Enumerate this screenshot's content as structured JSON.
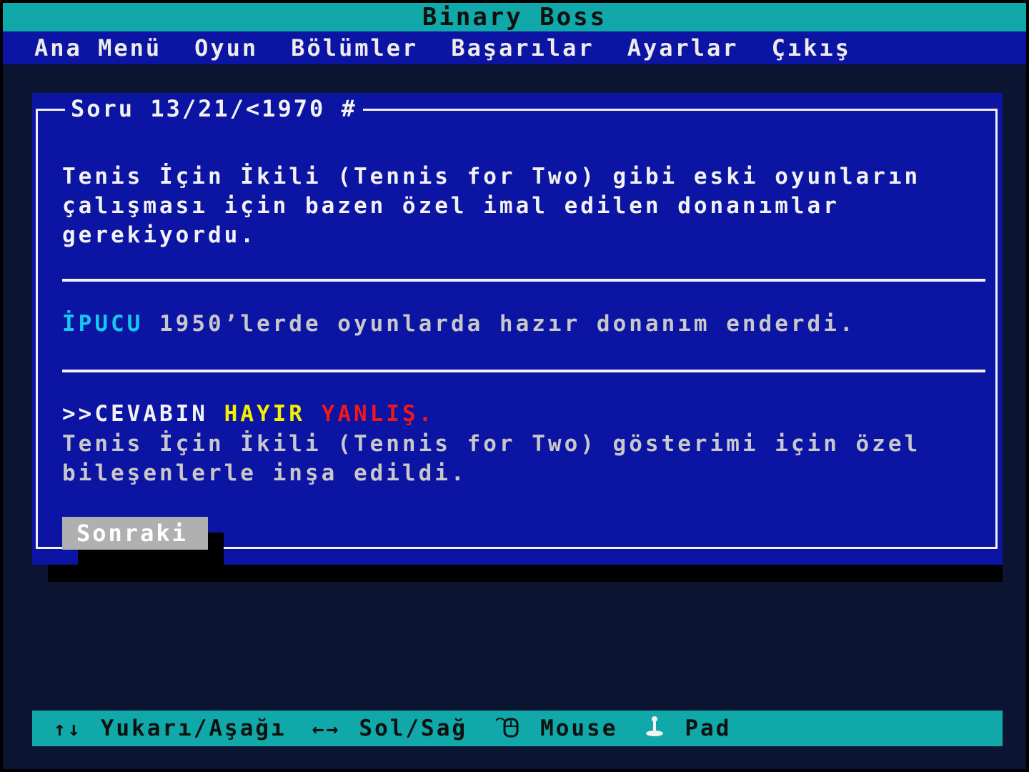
{
  "app": {
    "title": "Binary Boss"
  },
  "menu": {
    "items": [
      {
        "label": "Ana Menü"
      },
      {
        "label": "Oyun"
      },
      {
        "label": "Bölümler"
      },
      {
        "label": "Başarılar"
      },
      {
        "label": "Ayarlar"
      },
      {
        "label": "Çıkış"
      }
    ]
  },
  "question": {
    "header": "Soru 13/21/<1970 #",
    "text": "Tenis İçin İkili (Tennis for Two) gibi eski oyunların\nçalışması için bazen özel imal edilen donanımlar\ngerekiyordu."
  },
  "hint": {
    "label": "İPUCU",
    "text": "1950’lerde oyunlarda hazır donanım enderdi."
  },
  "result": {
    "prompt": ">>CEVABIN",
    "answer": "HAYIR",
    "verdict": "YANLIŞ.",
    "explanation": "Tenis İçin İkili (Tennis for Two) gösterimi için özel\nbileşenlerle inşa edildi."
  },
  "buttons": {
    "next_label": "Sonraki"
  },
  "statusbar": {
    "items": [
      {
        "icon": "up-down-arrows-icon",
        "glyph": "↑↓",
        "label": "Yukarı/Aşağı"
      },
      {
        "icon": "left-right-arrows-icon",
        "glyph": "←→",
        "label": "Sol/Sağ"
      },
      {
        "icon": "mouse-icon",
        "glyph": "",
        "label": "Mouse"
      },
      {
        "icon": "joystick-icon",
        "glyph": "",
        "label": "Pad"
      }
    ]
  },
  "colors": {
    "titlebar": "#10a8a8",
    "menubar": "#0c14a4",
    "dialog": "#0c14a4",
    "hint_label": "#14c8f0",
    "answer": "#f5f000",
    "verdict": "#f01818",
    "button": "#b0b0b0"
  }
}
